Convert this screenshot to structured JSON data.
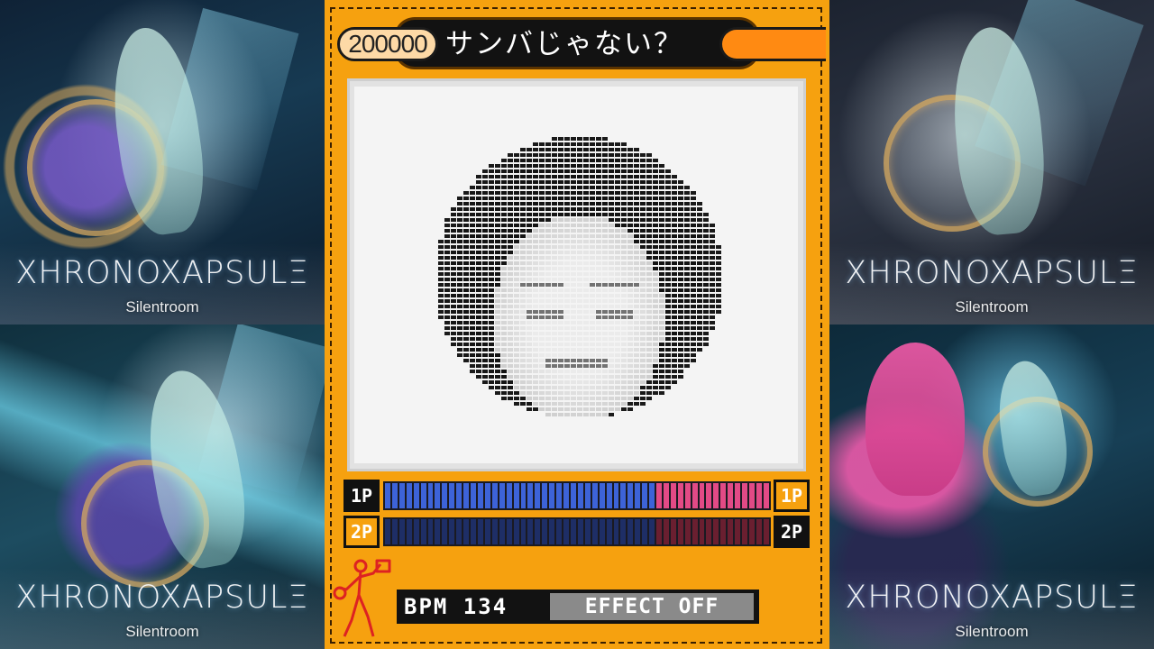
{
  "albums": [
    {
      "title": "XHRONOXAPSULΞ",
      "artist": "Silentroom"
    },
    {
      "title": "XHRONOXAPSULΞ",
      "artist": "Silentroom"
    },
    {
      "title": "XHRONOXAPSULΞ",
      "artist": "Silentroom"
    },
    {
      "title": "XHRONOXAPSULΞ",
      "artist": "Silentroom"
    }
  ],
  "game": {
    "score": "200000",
    "song_title": "サンバじゃない？",
    "player1_label": "1P",
    "player2_label": "2P",
    "p1_meter_fill": 0.7,
    "p2_meter_fill": 0.7,
    "bpm_text": "BPM 134",
    "effect_text": "EFFECT OFF",
    "colors": {
      "panel": "#f6a10f",
      "p1_blue": "#3d63d8",
      "p1_pink": "#e24a86",
      "p2_blue": "#1e2e66",
      "p2_red": "#6a1f30"
    }
  }
}
